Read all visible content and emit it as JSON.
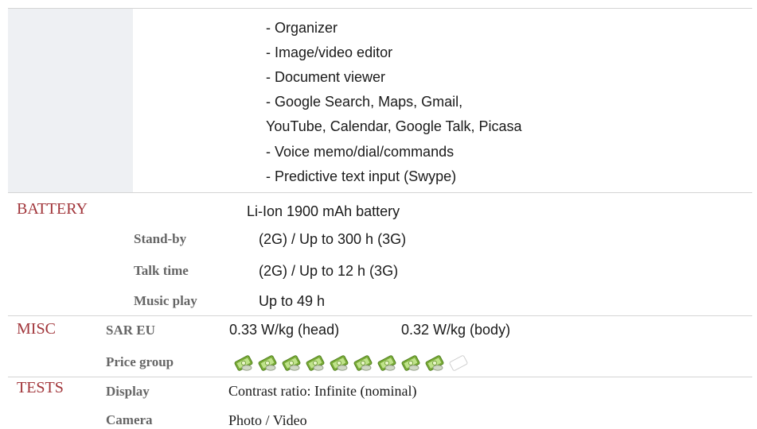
{
  "features_list": [
    "- Organizer",
    "- Image/video editor",
    "- Document viewer",
    "- Google Search, Maps, Gmail,",
    "YouTube, Calendar, Google Talk, Picasa",
    "- Voice memo/dial/commands",
    "- Predictive text input (Swype)"
  ],
  "battery": {
    "category": "BATTERY",
    "value": "Li-Ion 1900 mAh battery",
    "rows": [
      {
        "label": "Stand-by",
        "value": "(2G) / Up to 300 h (3G)"
      },
      {
        "label": "Talk time",
        "value": "(2G) / Up to 12 h (3G)"
      },
      {
        "label": "Music play",
        "value": "Up to 49 h"
      }
    ]
  },
  "misc": {
    "category": "MISC",
    "sar": {
      "label": "SAR EU",
      "head": "0.33 W/kg (head)",
      "body": "0.32 W/kg (body)"
    },
    "price": {
      "label": "Price group",
      "level": 9,
      "max": 10,
      "icon": "money-icon",
      "filled_color": "#8bc34a",
      "empty_color": "#ffffff"
    }
  },
  "tests": {
    "category": "TESTS",
    "rows": [
      {
        "label": "Display",
        "value": "Contrast ratio: Infinite (nominal)"
      },
      {
        "label": "Camera",
        "value": "Photo / Video"
      }
    ]
  }
}
